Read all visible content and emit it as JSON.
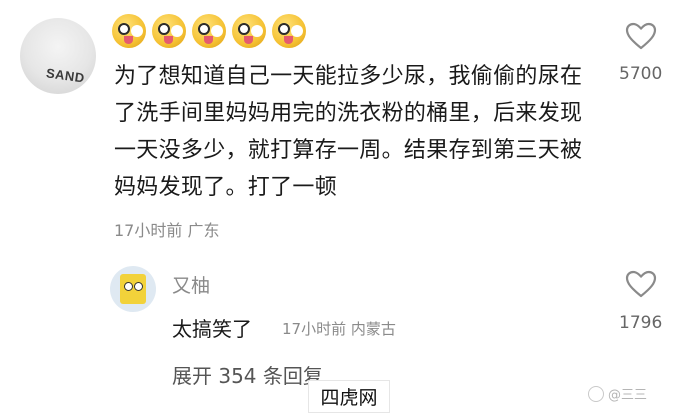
{
  "comment": {
    "avatar_shirt_text": "SAND",
    "emojis": [
      "zany-face",
      "zany-face",
      "zany-face",
      "zany-face",
      "zany-face"
    ],
    "text": "为了想知道自己一天能拉多少尿，我偷偷的尿在了洗手间里妈妈用完的洗衣粉的桶里，后来发现一天没多少，就打算存一周。结果存到第三天被妈妈发现了。打了一顿",
    "meta": "17小时前 广东",
    "like_count": "5700"
  },
  "reply": {
    "name": "又柚",
    "text": "太搞笑了",
    "meta": "17小时前 内蒙古",
    "like_count": "1796"
  },
  "expand_label": "展开 354 条回复",
  "watermark": {
    "site": "四虎网",
    "corner": "@三三"
  },
  "colors": {
    "text": "#1a1a1a",
    "muted": "#8a8a8a",
    "heart_outline": "#8a8a8a"
  }
}
